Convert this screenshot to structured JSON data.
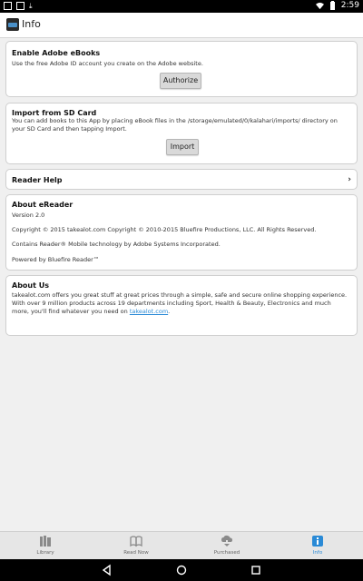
{
  "status_bar": {
    "time": "2:59"
  },
  "app_bar": {
    "title": "Info"
  },
  "adobe": {
    "title": "Enable Adobe eBooks",
    "description": "Use the free Adobe ID account you create on the Adobe website.",
    "button": "Authorize"
  },
  "import": {
    "title": "Import from SD Card",
    "description": "You can add books to this App by placing eBook files in the /storage/emulated/0/kalahari/imports/ directory on your SD Card and then tapping Import.",
    "button": "Import"
  },
  "reader_help": {
    "label": "Reader Help"
  },
  "about_ereader": {
    "title": "About eReader",
    "version": "Version 2.0",
    "copyright": "Copyright © 2015 takealot.com Copyright © 2010-2015 Bluefire Productions, LLC. All Rights Reserved.",
    "contains": "Contains Reader® Mobile technology by Adobe Systems Incorporated.",
    "powered": "Powered by Bluefire Reader™"
  },
  "about_us": {
    "title": "About Us",
    "text": "takealot.com offers you great stuff at great prices through a simple, safe and secure online shopping experience. With over 9 million products across 19 departments including Sport, Health & Beauty, Electronics and much more, you'll find whatever you need on ",
    "link": "takealot.com",
    "after_link": "."
  },
  "tabs": [
    {
      "label": "Library",
      "icon": "library-icon"
    },
    {
      "label": "Read Now",
      "icon": "book-icon"
    },
    {
      "label": "Purchased",
      "icon": "download-icon"
    },
    {
      "label": "Info",
      "icon": "info-icon"
    }
  ],
  "colors": {
    "accent": "#2a8ad6",
    "tab_bar": "#e6e6e6",
    "background": "#f0f0f0"
  }
}
